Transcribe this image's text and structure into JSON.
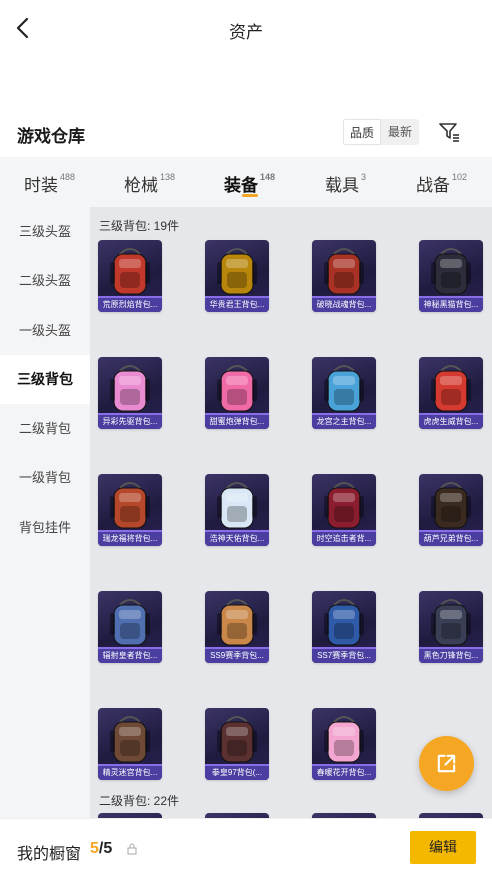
{
  "header": {
    "title": "资产"
  },
  "warehouse": {
    "title": "游戏仓库",
    "sort_quality": "品质",
    "sort_newest": "最新"
  },
  "tabs": [
    {
      "label": "时装",
      "count": "488"
    },
    {
      "label": "枪械",
      "count": "138"
    },
    {
      "label": "装备",
      "count": "148"
    },
    {
      "label": "载具",
      "count": "3"
    },
    {
      "label": "战备",
      "count": "102"
    }
  ],
  "sidebar": {
    "items": [
      {
        "label": "三级头盔"
      },
      {
        "label": "二级头盔"
      },
      {
        "label": "一级头盔"
      },
      {
        "label": "三级背包"
      },
      {
        "label": "二级背包"
      },
      {
        "label": "一级背包"
      },
      {
        "label": "背包挂件"
      }
    ]
  },
  "sections": [
    {
      "title": "三级背包: 19件",
      "items": [
        {
          "name": "荒原烈焰背包...",
          "color": "#c0392b"
        },
        {
          "name": "华贵君王背包...",
          "color": "#b8860b"
        },
        {
          "name": "破晓战魂背包...",
          "color": "#a93226"
        },
        {
          "name": "神秘黑猫背包...",
          "color": "#2c2c3a"
        },
        {
          "name": "异彩先驱背包...",
          "color": "#e88bd0"
        },
        {
          "name": "甜蜜炮弹背包...",
          "color": "#f06aa8"
        },
        {
          "name": "龙宫之主背包...",
          "color": "#4aa3d8"
        },
        {
          "name": "虎虎生威背包...",
          "color": "#d43a2f"
        },
        {
          "name": "瑞龙福将背包...",
          "color": "#b5472a"
        },
        {
          "name": "浩神天佑背包...",
          "color": "#d8e6f5"
        },
        {
          "name": "时空追击者背...",
          "color": "#8b1e2e"
        },
        {
          "name": "葫芦兄弟背包...",
          "color": "#3a2a20"
        },
        {
          "name": "辐射皇者背包...",
          "color": "#4f6fb0"
        },
        {
          "name": "SS9赛季背包...",
          "color": "#c9874a"
        },
        {
          "name": "SS7赛季背包...",
          "color": "#2f5aa8"
        },
        {
          "name": "黑色刀锋背包...",
          "color": "#3a3f55"
        },
        {
          "name": "精灵迷宫背包...",
          "color": "#6e4a36"
        },
        {
          "name": "拳皇97背包(...",
          "color": "#5a3030"
        },
        {
          "name": "春暖花开背包...",
          "color": "#f3a6d0"
        }
      ]
    },
    {
      "title": "二级背包: 22件"
    }
  ],
  "showcase": {
    "label": "我的橱窗",
    "current": "5",
    "total": "/5",
    "edit_label": "编辑"
  },
  "colors": {
    "accent": "#f5a623",
    "card_bg": "#241f4a",
    "label_bg": "#4a3fa0"
  }
}
